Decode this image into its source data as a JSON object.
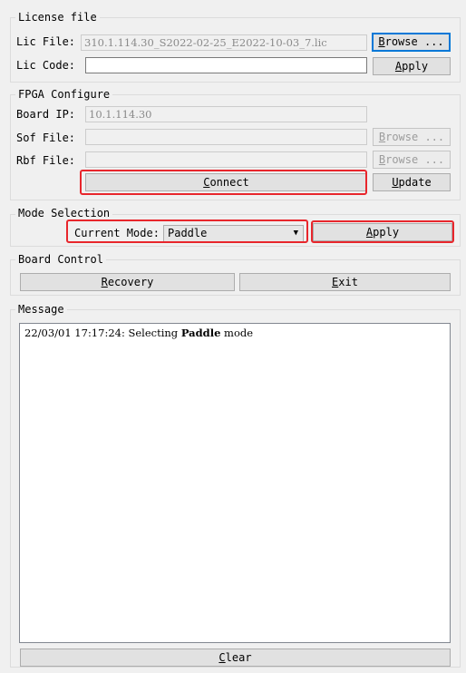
{
  "license": {
    "title": "License file",
    "lic_file_label": "Lic File:",
    "lic_file_value": "310.1.114.30_S2022-02-25_E2022-10-03_7.lic",
    "browse": {
      "pre": "",
      "acc": "B",
      "post": "rowse ..."
    },
    "lic_code_label": "Lic Code:",
    "lic_code_value": "",
    "apply": {
      "pre": "",
      "acc": "A",
      "post": "pply"
    }
  },
  "fpga": {
    "title": "FPGA Configure",
    "board_ip_label": "Board IP:",
    "board_ip_value": "10.1.114.30",
    "sof_label": "Sof File:",
    "sof_value": "",
    "sof_browse": {
      "pre": "",
      "acc": "B",
      "post": "rowse ..."
    },
    "rbf_label": "Rbf File:",
    "rbf_value": "",
    "rbf_browse": {
      "pre": "",
      "acc": "B",
      "post": "rowse ..."
    },
    "connect": {
      "pre": "",
      "acc": "C",
      "post": "onnect"
    },
    "update": {
      "pre": "",
      "acc": "U",
      "post": "pdate"
    }
  },
  "mode": {
    "title": "Mode Selection",
    "current_label": "Current Mode:",
    "current_value": "Paddle",
    "apply": {
      "pre": "",
      "acc": "A",
      "post": "pply"
    }
  },
  "board": {
    "title": "Board Control",
    "recovery": {
      "pre": "",
      "acc": "R",
      "post": "ecovery"
    },
    "exit": {
      "pre": "",
      "acc": "E",
      "post": "xit"
    }
  },
  "message": {
    "title": "Message",
    "line_prefix": "22/03/01 17:17:24: Selecting ",
    "line_bold": "Paddle",
    "line_suffix": " mode",
    "clear": {
      "pre": "",
      "acc": "C",
      "post": "lear"
    }
  },
  "colors": {
    "highlight": "#e8262c",
    "default_button_border": "#0078d7"
  }
}
